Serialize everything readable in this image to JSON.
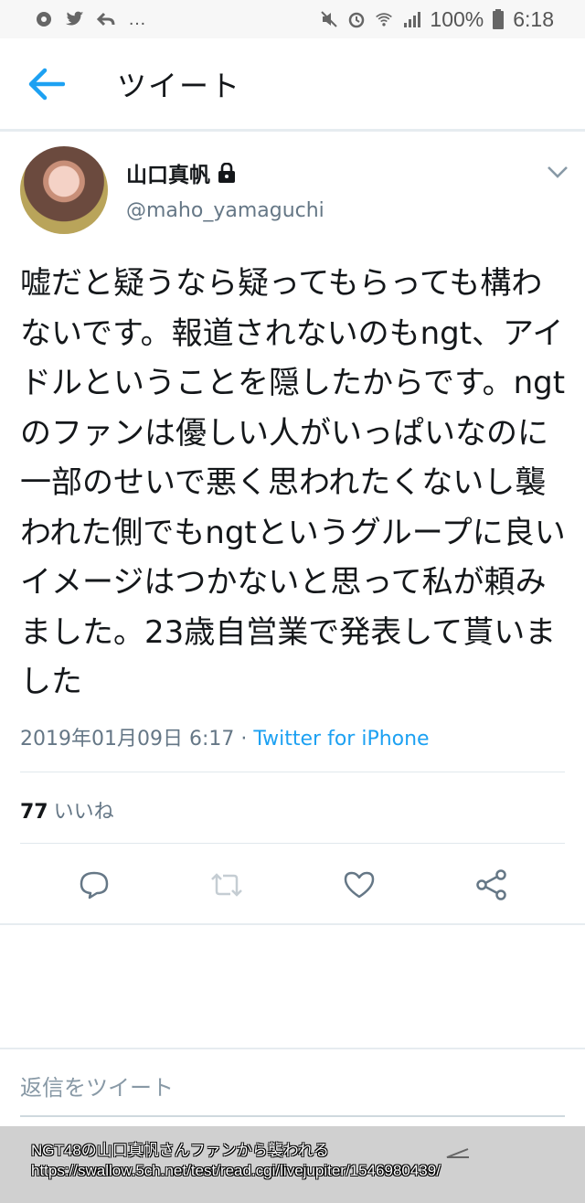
{
  "status_bar": {
    "left_icons": [
      "settings-icon",
      "twitter-icon",
      "reply-icon"
    ],
    "more": "…",
    "right_icons": [
      "mute-icon",
      "alarm-icon",
      "wifi-icon",
      "signal-icon"
    ],
    "battery": "100%",
    "time": "6:18"
  },
  "header": {
    "back_icon": "back-arrow-icon",
    "title": "ツイート"
  },
  "tweet": {
    "author_name": "山口真帆",
    "lock_icon": "lock-icon",
    "handle": "@maho_yamaguchi",
    "text": "嘘だと疑うなら疑ってもらっても構わないです。報道されないのもngt、アイドルということを隠したからです。ngtのファンは優しい人がいっぱいなのに一部のせいで悪く思われたくないし襲われた側でもngtというグループに良いイメージはつかないと思って私が頼みました。23歳自営業で発表して貰いました",
    "timestamp": "2019年01月09日 6:17",
    "separator": " · ",
    "source": "Twitter for iPhone",
    "likes_count": "77",
    "likes_label": "いいね",
    "accent_color": "#1da1f2"
  },
  "actions": [
    "reply-icon",
    "retweet-icon",
    "like-icon",
    "share-icon"
  ],
  "reply_placeholder": "返信をツイート",
  "watermark": {
    "line1": "NGT48の山口真帆さんファンから襲われる",
    "line2": "https://swallow.5ch.net/test/read.cgi/livejupiter/1546980439/"
  }
}
